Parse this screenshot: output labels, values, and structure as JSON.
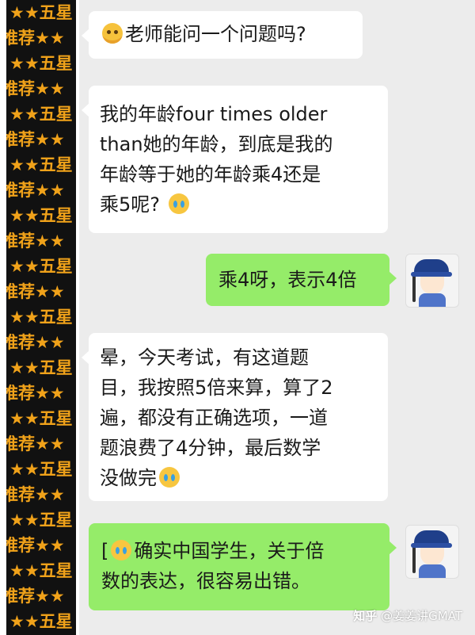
{
  "sidebar": {
    "row_a": "★★五星",
    "row_b": "推荐★★"
  },
  "messages": [
    {
      "sender": "them",
      "emoji": "sad-face",
      "text": "老师能问一个问题吗?"
    },
    {
      "sender": "them",
      "line1": "我的年龄four times older",
      "line2": "than她的年龄，到底是我的",
      "line3": "年龄等于她的年龄乘4还是",
      "line4": "乘5呢?",
      "emoji": "crying-laughing-face"
    },
    {
      "sender": "me",
      "text": "乘4呀，表示4倍"
    },
    {
      "sender": "them",
      "line1": "晕，今天考试，有这道题",
      "line2": "目，我按照5倍来算，算了2",
      "line3": "遍，都没有正确选项，一道",
      "line4": "题浪费了4分钟，最后数学",
      "line5": "没做完",
      "emoji": "crying-laughing-face"
    },
    {
      "sender": "me",
      "line1_prefix": "[",
      "line1": "确实中国学生，关于倍",
      "line2": "数的表达，很容易出错。",
      "emoji": "crying-face"
    }
  ],
  "watermark": {
    "platform": "知乎",
    "author": "@姜姜讲GMAT"
  },
  "colors": {
    "my_bubble": "#95ec69",
    "their_bubble": "#ffffff",
    "chat_bg": "#ececec",
    "strip_text": "#f0a21a"
  }
}
